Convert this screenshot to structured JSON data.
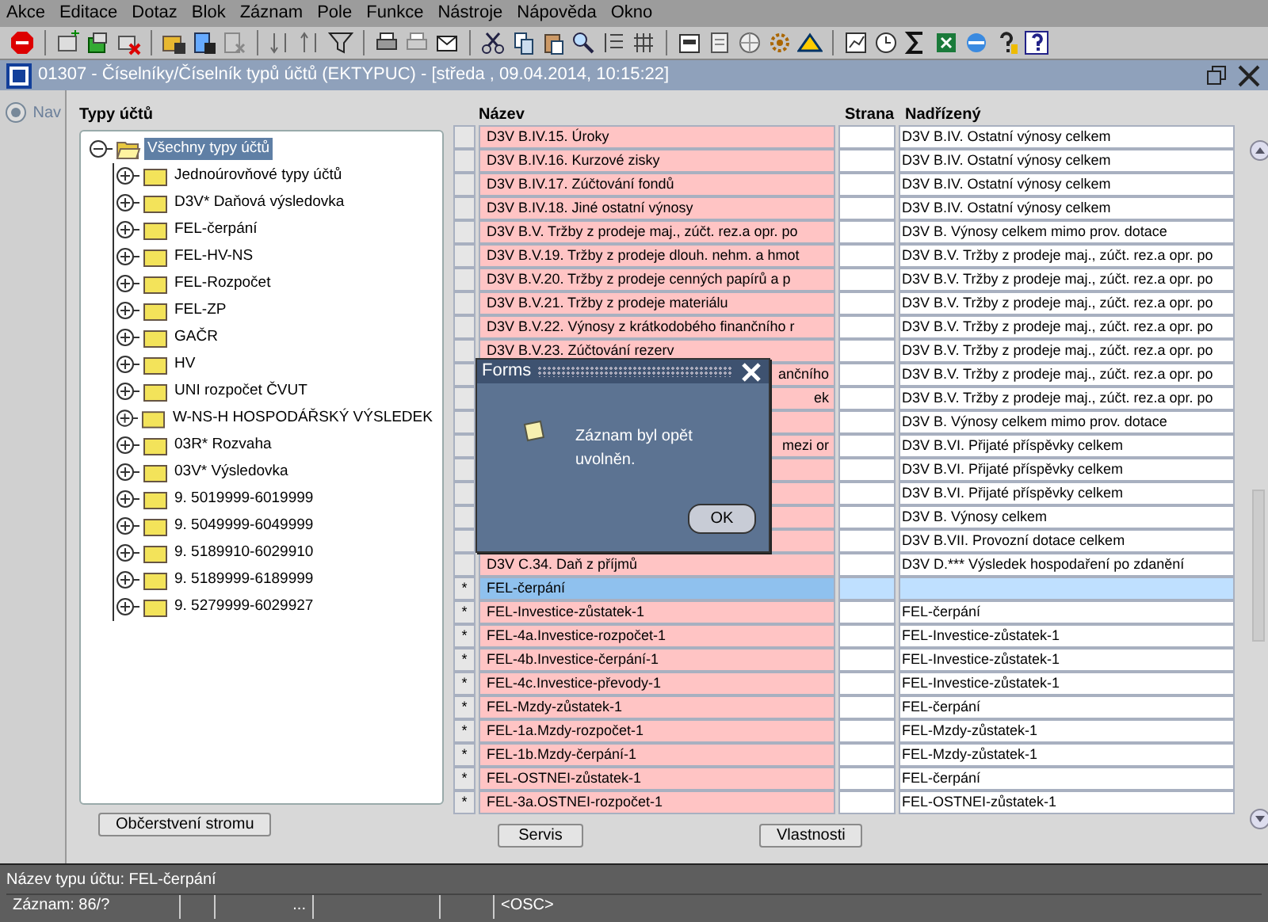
{
  "menu": [
    "Akce",
    "Editace",
    "Dotaz",
    "Blok",
    "Záznam",
    "Pole",
    "Funkce",
    "Nástroje",
    "Nápověda",
    "Okno"
  ],
  "window": {
    "title": "01307 - Číselníky/Číselník typů účtů (EKTYPUC) - [středa , 09.04.2014, 10:15:22]"
  },
  "nav": {
    "label": "Nav"
  },
  "tree": {
    "heading": "Typy účtů",
    "root": {
      "label": "Všechny typy účtů",
      "selected": true,
      "expanded": true,
      "children": [
        {
          "label": "Jednoúrovňové typy účtů",
          "selected": false,
          "expanded": false
        },
        {
          "label": "D3V* Daňová výsledovka",
          "selected": false,
          "expanded": false
        },
        {
          "label": "FEL-čerpání",
          "selected": false,
          "expanded": false
        },
        {
          "label": "FEL-HV-NS",
          "selected": false,
          "expanded": false
        },
        {
          "label": "FEL-Rozpočet",
          "selected": false,
          "expanded": false
        },
        {
          "label": "FEL-ZP",
          "selected": false,
          "expanded": false
        },
        {
          "label": "GAČR",
          "selected": false,
          "expanded": false
        },
        {
          "label": "HV",
          "selected": false,
          "expanded": false
        },
        {
          "label": "UNI rozpočet ČVUT",
          "selected": false,
          "expanded": false
        },
        {
          "label": "W-NS-H HOSPODÁŘSKÝ VÝSLEDEK",
          "selected": false,
          "expanded": false
        },
        {
          "label": "03R* Rozvaha",
          "selected": false,
          "expanded": false
        },
        {
          "label": "03V* Výsledovka",
          "selected": false,
          "expanded": false
        },
        {
          "label": "9. 5019999-6019999",
          "selected": false,
          "expanded": false
        },
        {
          "label": "9. 5049999-6049999",
          "selected": false,
          "expanded": false
        },
        {
          "label": "9. 5189910-6029910",
          "selected": false,
          "expanded": false
        },
        {
          "label": "9. 5189999-6189999",
          "selected": false,
          "expanded": false
        },
        {
          "label": "9. 5279999-6029927",
          "selected": false,
          "expanded": false
        }
      ]
    },
    "button": "Občerstvení stromu"
  },
  "table": {
    "columns": [
      "Název",
      "Strana",
      "Nadřízený"
    ],
    "rows": [
      {
        "marker": "",
        "name": "D3V B.IV.15. Úroky",
        "parent": "D3V B.IV. Ostatní výnosy celkem",
        "selected": false
      },
      {
        "marker": "",
        "name": "D3V B.IV.16. Kurzové zisky",
        "parent": "D3V B.IV. Ostatní výnosy celkem",
        "selected": false
      },
      {
        "marker": "",
        "name": "D3V B.IV.17. Zúčtování fondů",
        "parent": "D3V B.IV. Ostatní výnosy celkem",
        "selected": false
      },
      {
        "marker": "",
        "name": "D3V B.IV.18. Jiné ostatní výnosy",
        "parent": "D3V B.IV. Ostatní výnosy celkem",
        "selected": false
      },
      {
        "marker": "",
        "name": "D3V B.V. Tržby z prodeje maj., zúčt. rez.a opr. po",
        "parent": "D3V B. Výnosy celkem mimo prov. dotace",
        "selected": false
      },
      {
        "marker": "",
        "name": "D3V B.V.19. Tržby z prodeje dlouh. nehm. a hmot",
        "parent": "D3V B.V. Tržby z prodeje maj., zúčt. rez.a opr. po",
        "selected": false
      },
      {
        "marker": "",
        "name": "D3V B.V.20. Tržby z prodeje cenných papírů a p",
        "parent": "D3V B.V. Tržby z prodeje maj., zúčt. rez.a opr. po",
        "selected": false
      },
      {
        "marker": "",
        "name": "D3V B.V.21. Tržby z prodeje materiálu",
        "parent": "D3V B.V. Tržby z prodeje maj., zúčt. rez.a opr. po",
        "selected": false
      },
      {
        "marker": "",
        "name": "D3V B.V.22. Výnosy z krátkodobého finančního r",
        "parent": "D3V B.V. Tržby z prodeje maj., zúčt. rez.a opr. po",
        "selected": false
      },
      {
        "marker": "",
        "name": "D3V B.V.23. Zúčtování rezerv",
        "parent": "D3V B.V. Tržby z prodeje maj., zúčt. rez.a opr. po",
        "selected": false
      },
      {
        "kind": "covered",
        "name": "ančního",
        "parent": "D3V B.V. Tržby z prodeje maj., zúčt. rez.a opr. po",
        "selected": false
      },
      {
        "kind": "covered",
        "name": "ek",
        "parent": "D3V B.V. Tržby z prodeje maj., zúčt. rez.a opr. po",
        "selected": false
      },
      {
        "kind": "covered",
        "parent": "D3V B. Výnosy celkem mimo prov. dotace",
        "selected": false
      },
      {
        "kind": "covered",
        "name": "mezi or",
        "parent": "D3V B.VI. Přijaté příspěvky celkem",
        "selected": false
      },
      {
        "kind": "covered",
        "parent": "D3V B.VI. Přijaté příspěvky celkem",
        "selected": false
      },
      {
        "kind": "covered",
        "parent": "D3V B.VI. Přijaté příspěvky celkem",
        "selected": false
      },
      {
        "kind": "covered",
        "parent": "D3V B. Výnosy celkem",
        "selected": false
      },
      {
        "kind": "covered",
        "parent": "D3V B.VII. Provozní dotace celkem",
        "selected": false
      },
      {
        "marker": "",
        "name": "D3V C.34. Daň z příjmů",
        "parent": "D3V D.*** Výsledek hospodaření po zdanění",
        "selected": false
      },
      {
        "marker": "*",
        "name": "FEL-čerpání",
        "selected": true
      },
      {
        "marker": "*",
        "name": "FEL-Investice-zůstatek-1",
        "parent": "FEL-čerpání",
        "selected": false
      },
      {
        "marker": "*",
        "name": "FEL-4a.Investice-rozpočet-1",
        "parent": "FEL-Investice-zůstatek-1",
        "selected": false
      },
      {
        "marker": "*",
        "name": "FEL-4b.Investice-čerpání-1",
        "parent": "FEL-Investice-zůstatek-1",
        "selected": false
      },
      {
        "marker": "*",
        "name": "FEL-4c.Investice-převody-1",
        "parent": "FEL-Investice-zůstatek-1",
        "selected": false
      },
      {
        "marker": "*",
        "name": "FEL-Mzdy-zůstatek-1",
        "parent": "FEL-čerpání",
        "selected": false
      },
      {
        "marker": "*",
        "name": "FEL-1a.Mzdy-rozpočet-1",
        "parent": "FEL-Mzdy-zůstatek-1",
        "selected": false
      },
      {
        "marker": "*",
        "name": "FEL-1b.Mzdy-čerpání-1",
        "parent": "FEL-Mzdy-zůstatek-1",
        "selected": false
      },
      {
        "marker": "*",
        "name": "FEL-OSTNEI-zůstatek-1",
        "parent": "FEL-čerpání",
        "selected": false
      },
      {
        "marker": "*",
        "name": "FEL-3a.OSTNEI-rozpočet-1",
        "parent": "FEL-OSTNEI-zůstatek-1",
        "selected": false
      }
    ],
    "buttons": [
      "Servis",
      "Vlastnosti"
    ]
  },
  "dialog": {
    "title": "Forms",
    "message": "Záznam byl opět uvolněn.",
    "button": "OK"
  },
  "status_bar": {
    "message": "Název typu účtu: FEL-čerpání",
    "record": "Záznam: 86/?",
    "field_3": "...",
    "mode": "<OSC>"
  }
}
